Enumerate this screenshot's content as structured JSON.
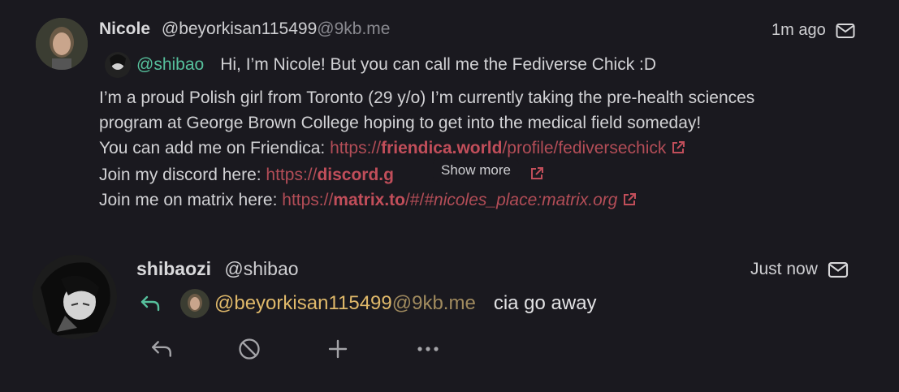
{
  "post1": {
    "author_name": "Nicole",
    "author_handle": "@beyorkisan115499",
    "author_host": "@9kb.me",
    "time": "1m ago",
    "mention": "@shibao",
    "greeting": "Hi, I’m Nicole! But you can call me the Fediverse Chick :D",
    "line1": "I’m a proud Polish girl from Toronto (29 y/o) I’m currently taking the pre-health sciences",
    "line2": "program at George Brown College hoping to get into the medical field someday!",
    "line3_label": "You can add me on Friendica: ",
    "friendica_scheme": "https://",
    "friendica_host": "friendica.world",
    "friendica_path": "/profile/fediversechick",
    "line4_label": "Join my discord here: ",
    "discord_scheme": "https://",
    "discord_host": "discord.g",
    "line5_label": "Join me on matrix here: ",
    "matrix_scheme": "https://",
    "matrix_host": "matrix.to",
    "matrix_path": "/#/",
    "matrix_room": "#nicoles_place:matrix.org",
    "show_more": "Show more"
  },
  "post2": {
    "author_name": "shibaozi",
    "author_handle": "@shibao",
    "time": "Just now",
    "reply_to_handle": "@beyorkisan115499",
    "reply_to_host": "@9kb.me",
    "text": "cia go away"
  },
  "icons": {
    "mail": "mail-icon",
    "external": "external-link-icon",
    "reply": "reply-icon",
    "block": "block-icon",
    "plus": "plus-icon",
    "more": "more-icon"
  },
  "colors": {
    "background": "#1a191f",
    "mention": "#56c09c",
    "link": "#c14e5a",
    "handle_mention": "#e0b96a"
  }
}
